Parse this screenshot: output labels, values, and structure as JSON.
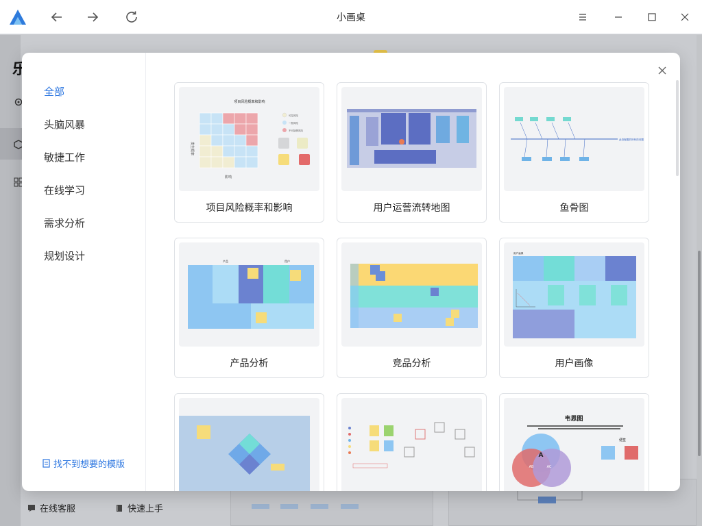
{
  "window": {
    "title": "小画桌"
  },
  "background": {
    "brand_char": "乐",
    "bottom_links": [
      "在线客服",
      "快速上手"
    ]
  },
  "modal": {
    "categories": [
      "全部",
      "头脑风暴",
      "敏捷工作",
      "在线学习",
      "需求分析",
      "规划设计"
    ],
    "active_category": "全部",
    "help_link": "找不到想要的模版",
    "templates": [
      {
        "label": "项目风险概率和影响",
        "thumb_title": "项目风险概率和影响",
        "thumb_xlabel": "影响",
        "thumb_ylabel": "发生概率",
        "legend": [
          "可控风险",
          "一般风险",
          "不可接受风险"
        ]
      },
      {
        "label": "用户运营流转地图"
      },
      {
        "label": "鱼骨图",
        "thumb_text": "此流程图的所有的问题"
      },
      {
        "label": "产品分析",
        "thumb_headers": [
          "产品",
          "用户"
        ]
      },
      {
        "label": "竞品分析"
      },
      {
        "label": "用户画像",
        "thumb_header": "用户画像"
      },
      {
        "label": ""
      },
      {
        "label": ""
      },
      {
        "label": "",
        "thumb_title": "韦恩图",
        "venn_labels": [
          "A",
          "AB",
          "AC"
        ],
        "thumb_tag": "便签"
      }
    ]
  },
  "colors": {
    "accent": "#2c76e0",
    "risk_red": "#eca6ab",
    "risk_blue": "#c7e3f6",
    "risk_yellow": "#f1edd2"
  }
}
